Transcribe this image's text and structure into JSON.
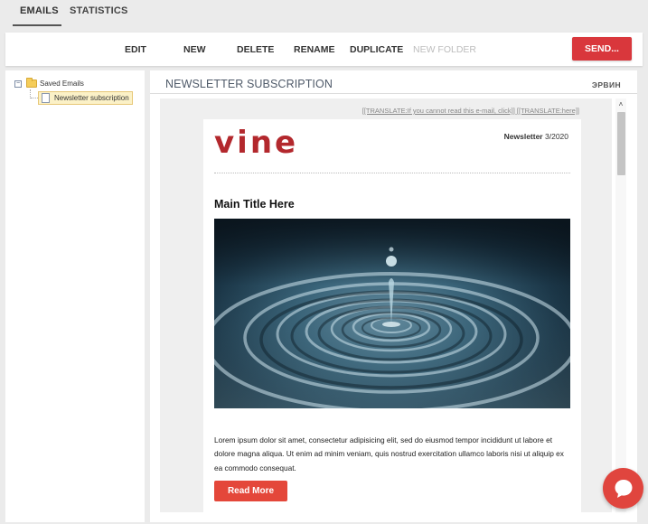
{
  "top_tabs": [
    {
      "label": "EMAILS",
      "active": true
    },
    {
      "label": "STATISTICS",
      "active": false
    }
  ],
  "toolbar": {
    "edit": "EDIT",
    "new": "NEW",
    "delete": "DELETE",
    "rename": "RENAME",
    "duplicate": "DUPLICATE",
    "new_folder": "NEW FOLDER",
    "send": "SEND..."
  },
  "tree": {
    "root_label": "Saved Emails",
    "expander_symbol": "−",
    "child_label": "Newsletter subscription"
  },
  "main": {
    "title": "NEWSLETTER SUBSCRIPTION",
    "user": "ЭРВИН"
  },
  "email": {
    "translate_line": "[[TRANSLATE:If you cannot read this e-mail, click]] [[TRANSLATE:here]]",
    "logo_text": "vine",
    "newsletter_word": "Newsletter",
    "issue": "3/2020",
    "title": "Main Title Here",
    "body": "Lorem ipsum dolor sit amet, consectetur adipisicing elit, sed do eiusmod tempor incididunt ut labore et dolore magna aliqua. Ut enim ad minim veniam, quis nostrud exercitation ullamco laboris nisi ut aliquip ex ea commodo consequat.",
    "read_more": "Read More"
  },
  "scrollbar": {
    "up_arrow": "˄"
  },
  "colors": {
    "brand_red": "#b3282d",
    "send_red": "#d9373c",
    "button_red": "#e4473a",
    "fab_red": "#e0453e"
  },
  "icons": {
    "tree_root": "folder-icon",
    "tree_child": "document-icon",
    "chat": "chat-bubble-icon",
    "hero": "water-drop-image"
  }
}
